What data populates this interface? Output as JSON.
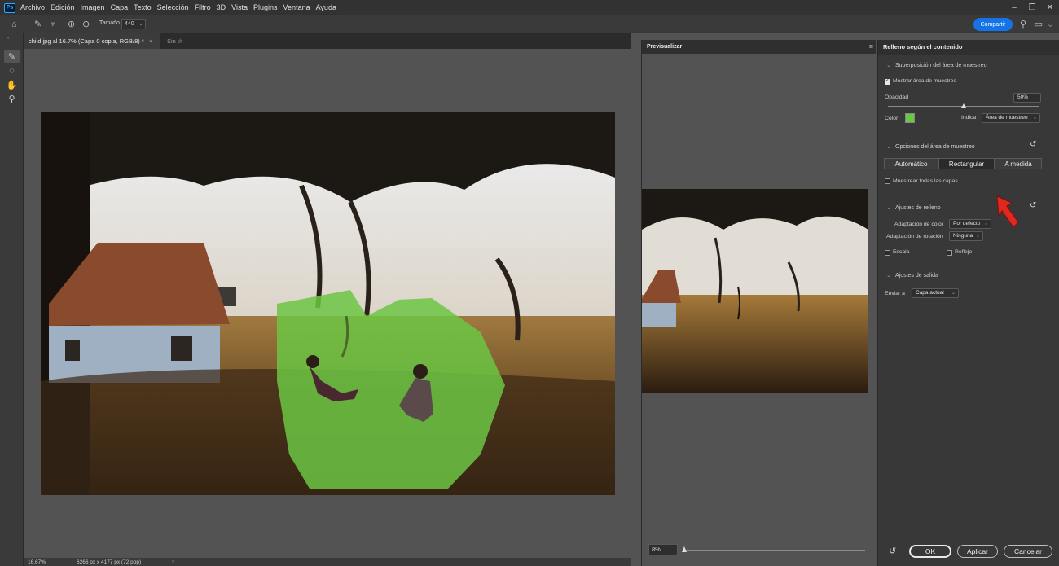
{
  "app": {
    "logo": "Ps",
    "menu": [
      "Archivo",
      "Edición",
      "Imagen",
      "Capa",
      "Texto",
      "Selección",
      "Filtro",
      "3D",
      "Vista",
      "Plugins",
      "Ventana",
      "Ayuda"
    ],
    "icons": [
      "photoshop-logo",
      "minimize-icon",
      "restore-icon",
      "close-icon"
    ]
  },
  "options_bar": {
    "size_label": "Tamaño",
    "size_value": "440",
    "share_label": "Compartir",
    "icons": [
      "home-icon",
      "brush-tool-icon",
      "add-brush-icon",
      "subtract-brush-icon",
      "search-icon",
      "workspace-icon"
    ]
  },
  "tabs": {
    "active": "child.jpg al 16.7% (Capa 0 copia, RGB/8) *",
    "close": "×",
    "second": "Sin tít"
  },
  "status": {
    "zoom": "16.67%",
    "dimensions": "6266 px x 4177 px (72 ppp)",
    "arrow": "›"
  },
  "preview": {
    "tab_label": "Previsualizar",
    "zoom_value": "8%",
    "slider_fraction": 0.0
  },
  "panel": {
    "title": "Relleno según el contenido",
    "section_overlay": "Superposición del área de muestreo",
    "show_sampling": "Mostrar área de muestreo",
    "show_sampling_checked": true,
    "opacity_label": "Opacidad",
    "opacity_value": "50%",
    "opacity_fraction": 0.5,
    "color_label": "Color",
    "color_swatch": "#6cc644",
    "indicates_label": "Indica",
    "indicates_value": "Área de muestreo",
    "section_sampling": "Opciones del área de muestreo",
    "segments": [
      "Automático",
      "Rectangular",
      "A medida"
    ],
    "active_segment": "Rectangular",
    "sample_all": "Muestrear todas las capas",
    "section_fill": "Ajustes de relleno",
    "color_adapt_label": "Adaptación de color",
    "color_adapt_value": "Por defecto",
    "rotation_adapt_label": "Adaptación de rotación",
    "rotation_adapt_value": "Ninguna",
    "scale_label": "Escala",
    "mirror_label": "Reflejo",
    "section_output": "Ajustes de salida",
    "output_label": "Enviar a",
    "output_value": "Capa actual",
    "ok_label": "OK",
    "apply_label": "Aplicar",
    "cancel_label": "Cancelar"
  }
}
